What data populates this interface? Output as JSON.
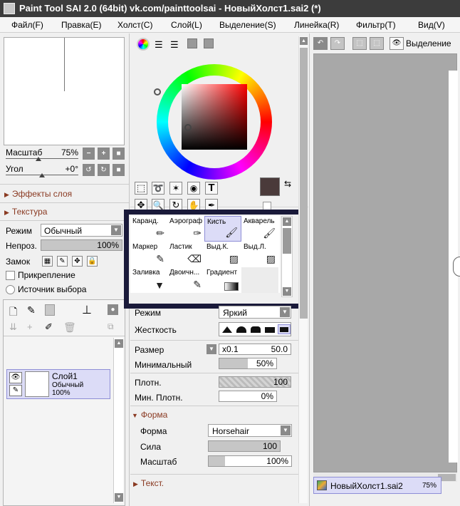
{
  "window": {
    "title": "Paint Tool SAI 2.0 (64bit) vk.com/painttoolsai - НовыйХолст1.sai2 (*)"
  },
  "menu": [
    "Файл(F)",
    "Правка(E)",
    "Холст(C)",
    "Слой(L)",
    "Выделение(S)",
    "Линейка(R)",
    "Фильтр(T)",
    "Вид(V)"
  ],
  "navigator": {
    "zoom_label": "Масштаб",
    "zoom_value": "75%",
    "angle_label": "Угол",
    "angle_value": "+0°"
  },
  "layer_panel": {
    "effects_label": "Эффекты слоя",
    "texture_label": "Текстура",
    "mode_label": "Режим",
    "mode_value": "Обычный",
    "opacity_label": "Непроз.",
    "opacity_value": "100%",
    "opacity_fraction": 1.0,
    "lock_label": "Замок",
    "clip_label": "Прикрепление",
    "source_label": "Источник выбора",
    "layer": {
      "name": "Слой1",
      "mode": "Обычный",
      "opacity": "100%"
    }
  },
  "tools": {
    "cells": [
      {
        "label": "Каранд.",
        "icon": "pencil-icon"
      },
      {
        "label": "Аэрограф",
        "icon": "airbrush-icon"
      },
      {
        "label": "Кисть",
        "icon": "brush-icon"
      },
      {
        "label": "Акварель",
        "icon": "watercolor-icon"
      },
      {
        "label": "Маркер",
        "icon": "marker-icon"
      },
      {
        "label": "Ластик",
        "icon": "eraser-icon"
      },
      {
        "label": "Выд.К.",
        "icon": "select-pen-icon"
      },
      {
        "label": "Выд.Л.",
        "icon": "deselect-pen-icon"
      },
      {
        "label": "Заливка",
        "icon": "bucket-icon"
      },
      {
        "label": "Двоичн...",
        "icon": "binary-pen-icon"
      },
      {
        "label": "Градиент",
        "icon": "gradient-icon"
      },
      {
        "label": "",
        "icon": ""
      }
    ],
    "selected": "Кисть"
  },
  "colors": {
    "primary": "#4a3a3a",
    "accent_frame": "#1a1a3a"
  },
  "brush": {
    "mode_label": "Режим",
    "mode_value": "Яркий",
    "hardness_label": "Жесткость",
    "size_label": "Размер",
    "size_mult": "x0.1",
    "size_value": "50.0",
    "size_fraction": 1.0,
    "min_label": "Минимальный",
    "min_value": "50%",
    "min_fraction": 0.5,
    "density_label": "Плотн.",
    "density_value": "100",
    "density_fraction": 1.0,
    "min_density_label": "Мин. Плотн.",
    "min_density_value": "0%",
    "min_density_fraction": 0.0,
    "shape_section": "Форма",
    "shape_label": "Форма",
    "shape_value": "Horsehair",
    "strength_label": "Сила",
    "strength_value": "100",
    "strength_fraction": 1.0,
    "scale_label": "Масштаб",
    "scale_value": "100%",
    "scale_fraction": 1.0,
    "texture_section": "Текст."
  },
  "canvas": {
    "selection_label": "Выделение",
    "doc_name": "НовыйХолст1.sai2",
    "doc_zoom": "75%"
  }
}
